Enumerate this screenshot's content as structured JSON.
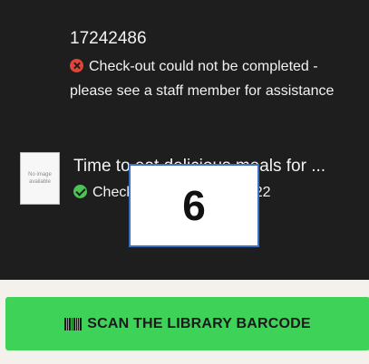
{
  "checkout_list": {
    "items": [
      {
        "id": "17242486",
        "status": {
          "type": "error",
          "icon": "error-circle-icon",
          "color": "#e0453a",
          "text": "Check-out could not be completed - please see a staff member for assistance"
        }
      },
      {
        "thumbnail_text": "No image\navailable",
        "title": "Time to eat delicious meals for ...",
        "status": {
          "type": "success",
          "icon": "check-circle-icon",
          "color": "#4cc257",
          "text": "Checked out. Due 06-30-22"
        }
      }
    ]
  },
  "overlay": {
    "label": "6"
  },
  "scan_button": {
    "icon": "barcode-icon",
    "label": "SCAN THE LIBRARY BARCODE",
    "color": "#3fd259"
  }
}
